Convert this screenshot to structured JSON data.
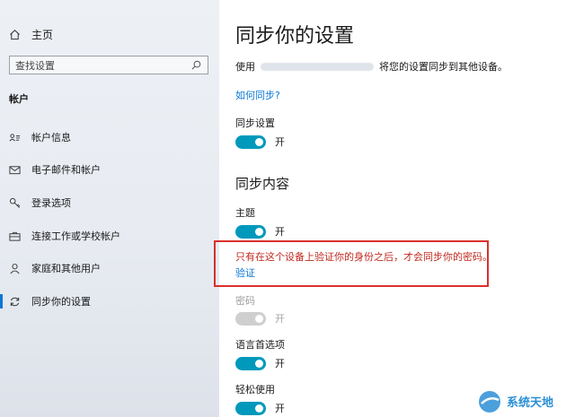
{
  "sidebar": {
    "home": {
      "label": "主页",
      "icon": "home-icon"
    },
    "search": {
      "placeholder": "查找设置",
      "icon": "search-icon"
    },
    "section_title": "帐户",
    "items": [
      {
        "label": "帐户信息",
        "icon": "person-card-icon"
      },
      {
        "label": "电子邮件和帐户",
        "icon": "mail-icon"
      },
      {
        "label": "登录选项",
        "icon": "key-icon"
      },
      {
        "label": "连接工作或学校帐户",
        "icon": "briefcase-icon"
      },
      {
        "label": "家庭和其他用户",
        "icon": "person-icon"
      },
      {
        "label": "同步你的设置",
        "icon": "sync-icon",
        "active": true
      }
    ]
  },
  "main": {
    "title": "同步你的设置",
    "sync_text_prefix": "使用",
    "sync_text_suffix": "将您的设置同步到其他设备。",
    "how_link": "如何同步?",
    "sync_settings": {
      "label": "同步设置",
      "state": "开"
    },
    "content_heading": "同步内容",
    "settings": [
      {
        "label": "主题",
        "state": "开",
        "on": true
      },
      {
        "label": "密码",
        "state": "开",
        "on": false
      },
      {
        "label": "语言首选项",
        "state": "开",
        "on": true
      },
      {
        "label": "轻松使用",
        "state": "开",
        "on": true
      }
    ],
    "notice": {
      "text": "只有在这个设备上验证你的身份之后，才会同步你的密码。",
      "verify_link": "验证"
    }
  },
  "watermark": {
    "text": "系统天地"
  },
  "colors": {
    "accent": "#0099bc",
    "link": "#0a78d7",
    "notice": "#c0281f",
    "box": "#d9302c"
  }
}
